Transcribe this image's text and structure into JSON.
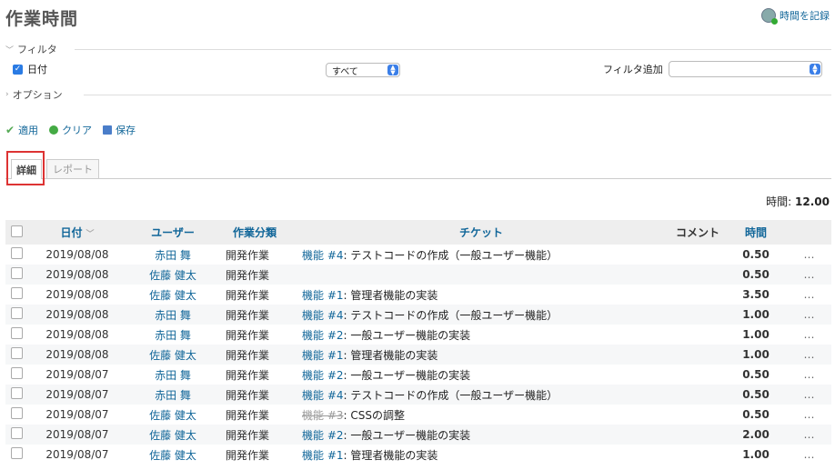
{
  "page": {
    "title": "作業時間",
    "log_time_label": "時間を記録"
  },
  "filters": {
    "legend": "フィルタ",
    "date_label": "日付",
    "date_operator": "すべて",
    "add_filter_label": "フィルタ追加",
    "add_filter_value": "",
    "options_legend": "オプション"
  },
  "actions": {
    "apply": "適用",
    "clear": "クリア",
    "save": "保存"
  },
  "tabs": {
    "details": "詳細",
    "report": "レポート"
  },
  "total": {
    "label": "時間:",
    "value": "12.00"
  },
  "table": {
    "headers": {
      "date": "日付",
      "user": "ユーザー",
      "activity": "作業分類",
      "ticket": "チケット",
      "comment": "コメント",
      "hours": "時間"
    },
    "rows": [
      {
        "date": "2019/08/08",
        "user": "赤田 舞",
        "activity": "開発作業",
        "ticket_ref": "機能 #4",
        "ticket_subject": ": テストコードの作成（一般ユーザー機能）",
        "closed": false,
        "hours": "0.50"
      },
      {
        "date": "2019/08/08",
        "user": "佐藤 健太",
        "activity": "開発作業",
        "ticket_ref": "",
        "ticket_subject": "",
        "closed": false,
        "hours": "0.50"
      },
      {
        "date": "2019/08/08",
        "user": "佐藤 健太",
        "activity": "開発作業",
        "ticket_ref": "機能 #1",
        "ticket_subject": ": 管理者機能の実装",
        "closed": false,
        "hours": "3.50"
      },
      {
        "date": "2019/08/08",
        "user": "赤田 舞",
        "activity": "開発作業",
        "ticket_ref": "機能 #4",
        "ticket_subject": ": テストコードの作成（一般ユーザー機能）",
        "closed": false,
        "hours": "1.00"
      },
      {
        "date": "2019/08/08",
        "user": "赤田 舞",
        "activity": "開発作業",
        "ticket_ref": "機能 #2",
        "ticket_subject": ": 一般ユーザー機能の実装",
        "closed": false,
        "hours": "1.00"
      },
      {
        "date": "2019/08/08",
        "user": "佐藤 健太",
        "activity": "開発作業",
        "ticket_ref": "機能 #1",
        "ticket_subject": ": 管理者機能の実装",
        "closed": false,
        "hours": "1.00"
      },
      {
        "date": "2019/08/07",
        "user": "赤田 舞",
        "activity": "開発作業",
        "ticket_ref": "機能 #2",
        "ticket_subject": ": 一般ユーザー機能の実装",
        "closed": false,
        "hours": "0.50"
      },
      {
        "date": "2019/08/07",
        "user": "赤田 舞",
        "activity": "開発作業",
        "ticket_ref": "機能 #4",
        "ticket_subject": ": テストコードの作成（一般ユーザー機能）",
        "closed": false,
        "hours": "0.50"
      },
      {
        "date": "2019/08/07",
        "user": "佐藤 健太",
        "activity": "開発作業",
        "ticket_ref": "機能 #3",
        "ticket_subject": ": CSSの調整",
        "closed": true,
        "hours": "0.50"
      },
      {
        "date": "2019/08/07",
        "user": "佐藤 健太",
        "activity": "開発作業",
        "ticket_ref": "機能 #2",
        "ticket_subject": ": 一般ユーザー機能の実装",
        "closed": false,
        "hours": "2.00"
      },
      {
        "date": "2019/08/07",
        "user": "佐藤 健太",
        "activity": "開発作業",
        "ticket_ref": "機能 #1",
        "ticket_subject": ": 管理者機能の実装",
        "closed": false,
        "hours": "1.00"
      }
    ]
  },
  "icons": {
    "row_menu": "…",
    "sort": "﹀",
    "checked": "✓"
  }
}
